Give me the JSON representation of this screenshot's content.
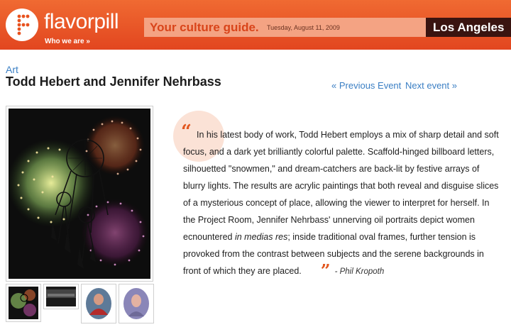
{
  "header": {
    "logo_text": "flavorpill",
    "who_link": "Who we are »",
    "tagline": "Your culture guide.",
    "date": "Tuesday, August 11, 2009",
    "city": "Los Angeles"
  },
  "event": {
    "category": "Art",
    "title": "Todd Hebert and Jennifer Nehrbass",
    "prev_label": "« Previous Event",
    "next_label": "Next event »"
  },
  "description": {
    "part1": "In his latest body of work, Todd Hebert employs a mix of sharp detail and soft focus, and a dark yet brilliantly colorful palette. Scaffold-hinged billboard letters, silhouetted \"snowmen,\" and dream-catchers are back-lit by festive arrays of blurry lights. The results are acrylic paintings that both reveal and disguise slices of a mysterious concept of place, allowing the viewer to interpret for herself.  In the Project Room, Jennifer Nehrbass' unnerving oil portraits depict women ecnountered ",
    "italic": "in medias res",
    "part2": "; inside traditional oval frames, further tension is provoked from the contrast between subjects and the serene backgrounds in front of which they are placed.",
    "author": "- Phil Kropoth"
  },
  "colors": {
    "header_orange": "#e8521f",
    "link_blue": "#3b7fc4",
    "city_bar": "#3a1410",
    "quote_mark": "#e2571f"
  },
  "icons": {
    "quote_open": "“",
    "quote_close": "”"
  }
}
